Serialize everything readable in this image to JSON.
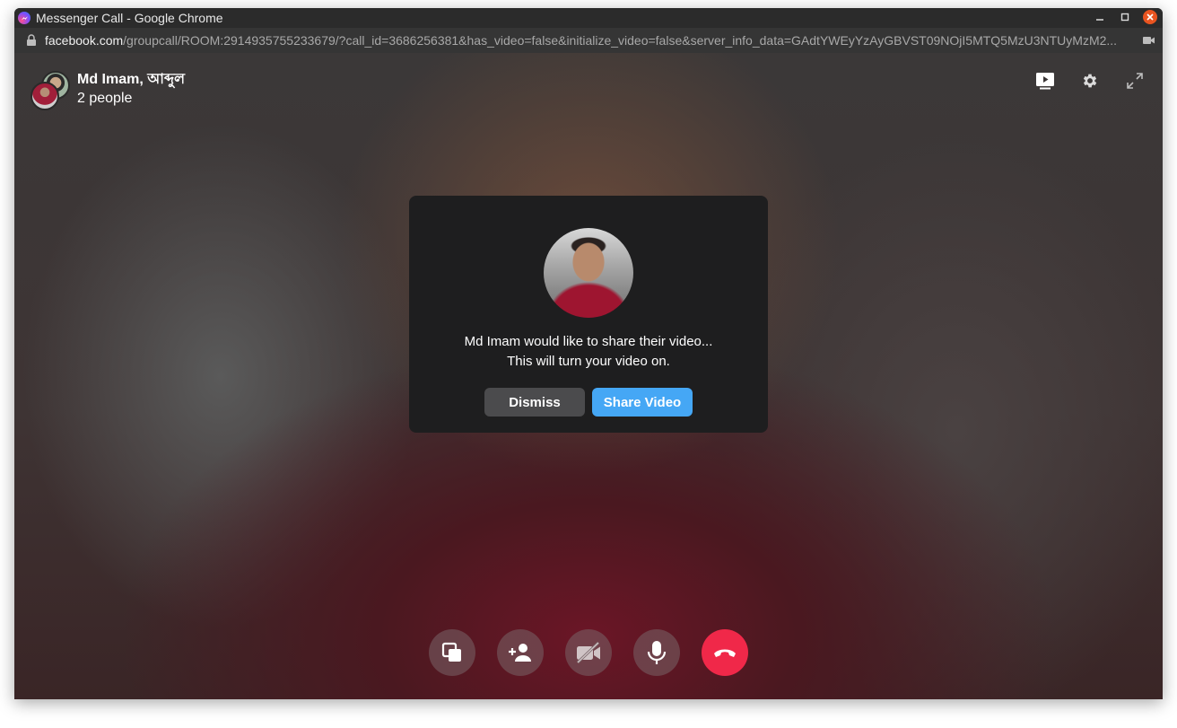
{
  "window": {
    "title": "Messenger Call - Google Chrome",
    "controls": [
      "minimize-icon",
      "maximize-icon",
      "close-icon"
    ]
  },
  "address_bar": {
    "host": "facebook.com",
    "path": "/groupcall/ROOM:2914935755233679/?call_id=3686256381&has_video=false&initialize_video=false&server_info_data=GAdtYWEyYzAyGBVST09NOjI5MTQ5MzU3NTUyMzM2..."
  },
  "call": {
    "title": "Md Imam, আব্দুল",
    "subtitle": "2 people"
  },
  "top_actions": [
    "screen-share-view-icon",
    "settings-icon",
    "fullscreen-icon"
  ],
  "dialog": {
    "line1": "Md Imam would like to share their video...",
    "line2": "This will turn your video on.",
    "dismiss_label": "Dismiss",
    "share_label": "Share Video"
  },
  "bottom_controls": [
    "share-screen-icon",
    "add-person-icon",
    "video-off-icon",
    "microphone-icon",
    "end-call-icon"
  ],
  "colors": {
    "share_button": "#45a7f5",
    "end_call": "#f02849",
    "dialog_bg": "#1e1e1f"
  }
}
